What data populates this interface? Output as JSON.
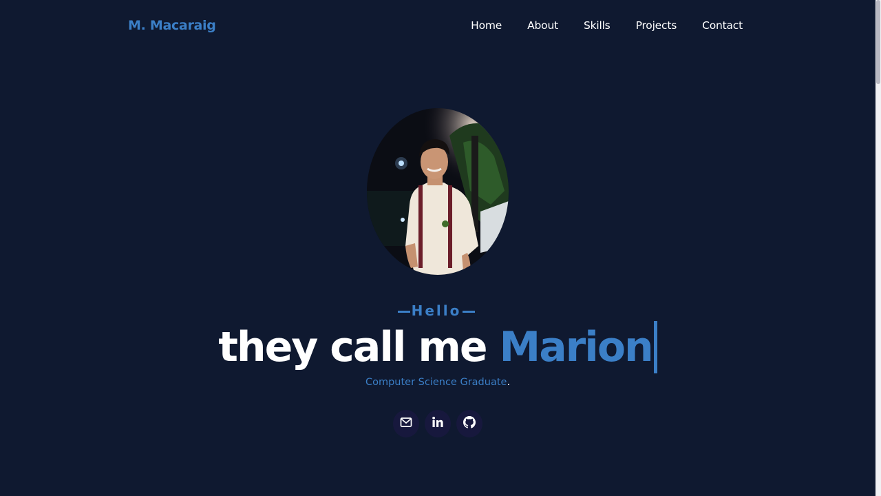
{
  "brand": {
    "logo": "M. Macaraig"
  },
  "nav": {
    "items": [
      "Home",
      "About",
      "Skills",
      "Projects",
      "Contact"
    ]
  },
  "hero": {
    "greeting": "Hello",
    "headline_prefix": "they call me ",
    "headline_name": "Marion",
    "subtitle": "Computer Science Graduate",
    "subtitle_end": "."
  },
  "socials": [
    {
      "icon": "mail-icon"
    },
    {
      "icon": "linkedin-icon"
    },
    {
      "icon": "github-icon"
    }
  ],
  "colors": {
    "background": "#0f1930",
    "accent": "#3b7fc7",
    "text": "#ffffff",
    "social_bg": "#17183d"
  }
}
